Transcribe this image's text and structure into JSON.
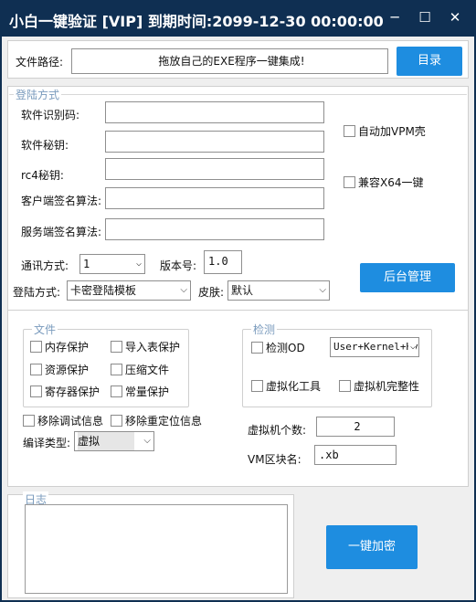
{
  "window": {
    "title": "小白一键验证 [VIP]  到期时间:2099-12-30 00:00:00",
    "minimize": "─",
    "maximize": "☐",
    "close": "✕"
  },
  "file_path": {
    "label": "文件路径:",
    "value": "拖放自己的EXE程序一键集成!",
    "browse_button": "目录"
  },
  "login_panel": {
    "legend": "登陆方式",
    "software_id_label": "软件识别码:",
    "software_key_label": "软件秘钥:",
    "rc4_key_label": "rc4秘钥:",
    "client_sign_label": "客户端签名算法:",
    "server_sign_label": "服务端签名算法:",
    "software_id_value": "",
    "software_key_value": "",
    "rc4_key_value": "",
    "client_sign_value": "",
    "server_sign_value": "",
    "vpm_check": "自动加VPM壳",
    "x64_check": "兼容X64一键",
    "comm_mode_label": "通讯方式:",
    "comm_mode_value": "1",
    "version_label": "版本号:",
    "version_value": "1.0",
    "admin_button": "后台管理",
    "login_mode_label": "登陆方式:",
    "login_mode_value": "卡密登陆模板",
    "skin_label": "皮肤:",
    "skin_value": "默认"
  },
  "protect_panel": {
    "file_legend": "文件",
    "memory_protect": "内存保护",
    "import_protect": "导入表保护",
    "resource_protect": "资源保护",
    "compress_file": "压缩文件",
    "register_protect": "寄存器保护",
    "const_protect": "常量保护",
    "remove_debug": "移除调试信息",
    "remove_reloc": "移除重定位信息",
    "compile_type_label": "编译类型:",
    "compile_type_value": "虚拟",
    "detect_legend": "检测",
    "detect_od": "检测OD",
    "detect_mode_value": "User+Kernel+Hy",
    "vm_tool": "虚拟化工具",
    "vm_integrity": "虚拟机完整性",
    "vm_count_label": "虚拟机个数:",
    "vm_count_value": "2",
    "vm_section_label": "VM区块名:",
    "vm_section_value": ".xb"
  },
  "log_panel": {
    "legend": "日志",
    "encrypt_button": "一键加密"
  }
}
